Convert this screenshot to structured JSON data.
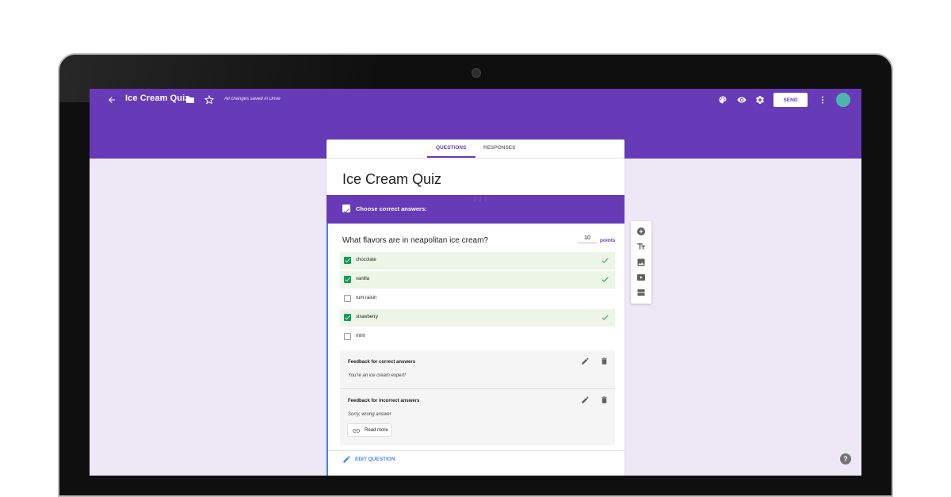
{
  "header": {
    "title": "Ice Cream Quiz",
    "saved_status": "All changes saved in Drive",
    "send_label": "SEND",
    "icons": [
      "back-arrow-icon",
      "folder-icon",
      "star-icon",
      "palette-icon",
      "eye-icon",
      "gear-icon",
      "more-vert-icon"
    ],
    "accent_color": "#673ab7",
    "avatar_color": "#4db6ac"
  },
  "tabs": [
    {
      "label": "QUESTIONS",
      "active": true
    },
    {
      "label": "RESPONSES",
      "active": false
    }
  ],
  "form": {
    "title": "Ice Cream Quiz"
  },
  "answer_key": {
    "heading": "Choose correct answers:"
  },
  "question": {
    "text": "What flavors are in neapolitan ice cream?",
    "points_value": "10",
    "points_label": "points",
    "options": [
      {
        "label": "chocolate",
        "checked": true,
        "correct": true
      },
      {
        "label": "vanilla",
        "checked": true,
        "correct": true
      },
      {
        "label": "rum raisin",
        "checked": false,
        "correct": false
      },
      {
        "label": "strawberry",
        "checked": true,
        "correct": true
      },
      {
        "label": "mint",
        "checked": false,
        "correct": false
      }
    ]
  },
  "feedback": {
    "correct_title": "Feedback for correct answers",
    "correct_text": "You're an ice cream expert!",
    "incorrect_title": "Feedback for incorrect answers",
    "incorrect_text": "Sorry, wrong answer",
    "read_more_label": "Read more"
  },
  "edit_question_label": "EDIT QUESTION",
  "side_tools": [
    "add-question-icon",
    "title-text-icon",
    "image-icon",
    "video-icon",
    "section-icon"
  ],
  "help_label": "?"
}
